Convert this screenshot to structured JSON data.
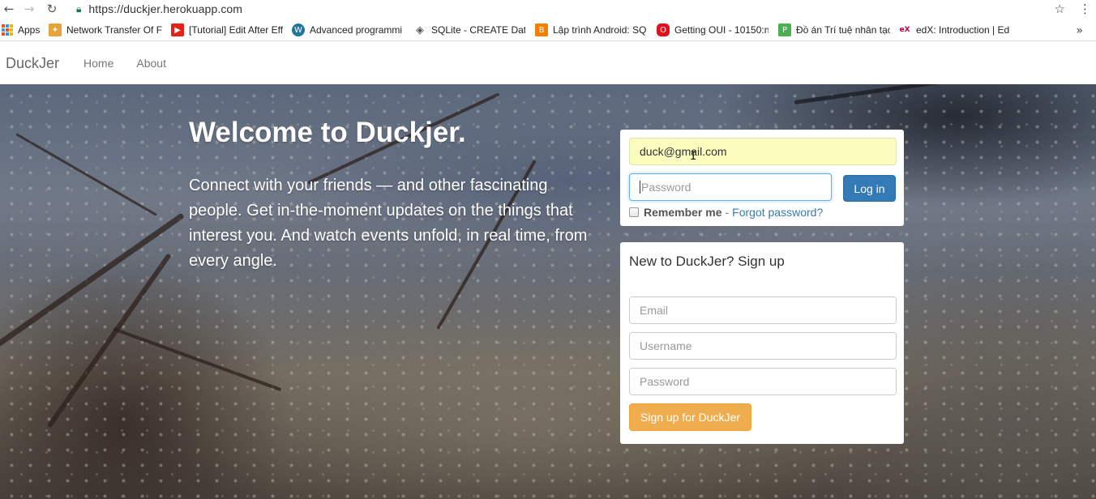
{
  "browser": {
    "url": "https://duckjer.herokuapp.com",
    "bookmarks": [
      {
        "label": "Apps",
        "icon": "apps-grid-icon",
        "color": "#e4532e"
      },
      {
        "label": "Network Transfer Of F",
        "icon": "puzzle-icon",
        "color": "#e8a33a"
      },
      {
        "label": "[Tutorial] Edit After Eff",
        "icon": "youtube-icon",
        "color": "#e62117"
      },
      {
        "label": "Advanced programmi",
        "icon": "wordpress-icon",
        "color": "#21759b"
      },
      {
        "label": "SQLite - CREATE Data",
        "icon": "diamond-icon",
        "color": "#555555"
      },
      {
        "label": "Lập trình Android: SQ",
        "icon": "blogger-icon",
        "color": "#f57d00"
      },
      {
        "label": "Getting OUI - 10150:n",
        "icon": "oracle-icon",
        "color": "#e0111b"
      },
      {
        "label": "Đồ án Trí tuệ nhân tạo",
        "icon": "p-icon",
        "color": "#4caf50"
      },
      {
        "label": "edX: Introduction | Ed",
        "icon": "edx-icon",
        "color": "#b9003f"
      }
    ]
  },
  "site": {
    "brand": "DuckJer",
    "nav": [
      {
        "label": "Home"
      },
      {
        "label": "About"
      }
    ]
  },
  "hero": {
    "title": "Welcome to Duckjer.",
    "description": "Connect with your friends — and other fascinating people. Get in-the-moment updates on the things that interest you. And watch events unfold, in real time, from every angle."
  },
  "login": {
    "email_value": "duck@gmail.com",
    "password_placeholder": "Password",
    "login_button": "Log in",
    "remember_label": "Remember me",
    "separator": "-",
    "forgot_link": "Forgot password?"
  },
  "signup": {
    "title": "New to DuckJer? Sign up",
    "email_placeholder": "Email",
    "username_placeholder": "Username",
    "password_placeholder": "Password",
    "button": "Sign up for DuckJer"
  }
}
